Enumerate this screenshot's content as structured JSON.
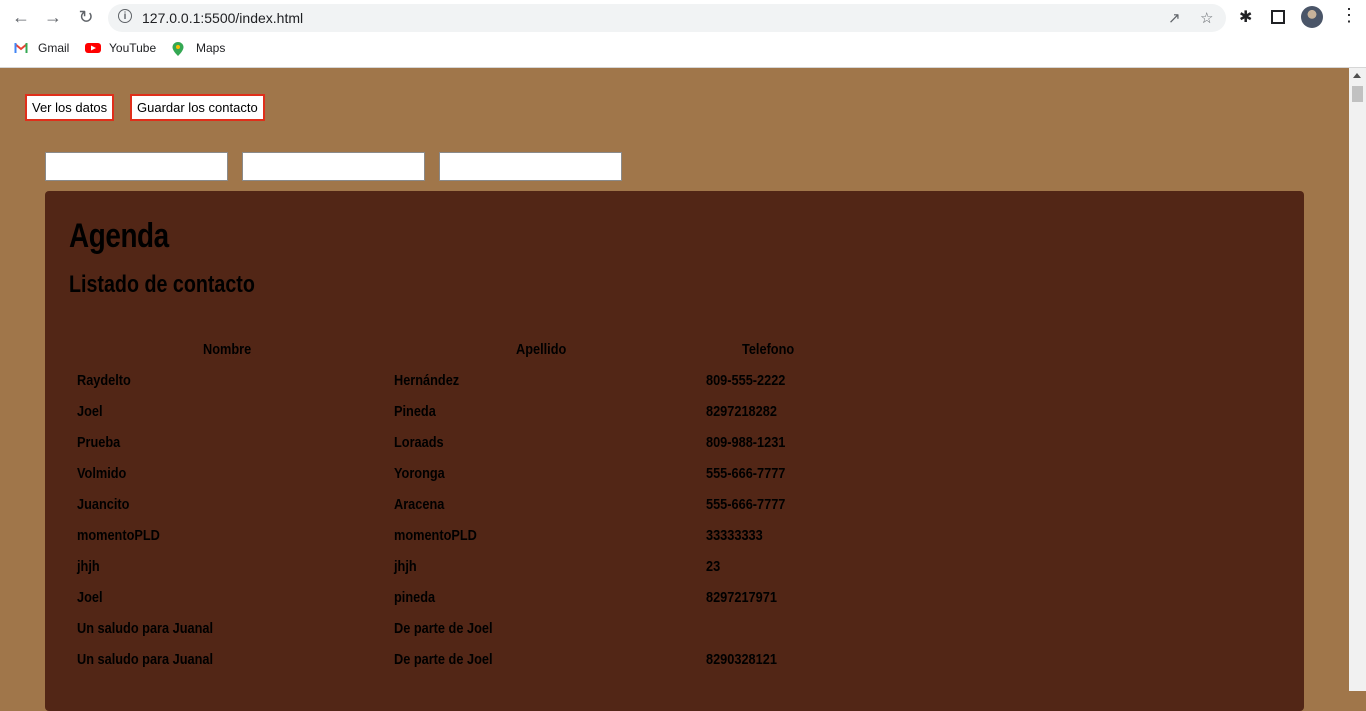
{
  "browser": {
    "url": "127.0.0.1:5500/index.html",
    "bookmarks": [
      {
        "label": "Gmail",
        "icon": "gmail-icon"
      },
      {
        "label": "YouTube",
        "icon": "youtube-icon"
      },
      {
        "label": "Maps",
        "icon": "maps-icon"
      }
    ]
  },
  "toolbar": {
    "view_label": "Ver los datos",
    "save_label": "Guardar los contacto"
  },
  "form": {
    "fields": [
      {
        "value": "",
        "placeholder": ""
      },
      {
        "value": "",
        "placeholder": ""
      },
      {
        "value": "",
        "placeholder": ""
      }
    ]
  },
  "agenda": {
    "title": "Agenda",
    "subtitle": "Listado de contacto",
    "headers": [
      "Nombre",
      "Apellido",
      "Telefono"
    ],
    "rows": [
      {
        "nombre": "Raydelto",
        "apellido": "Hernández",
        "telefono": "809-555-2222"
      },
      {
        "nombre": "Joel",
        "apellido": "Pineda",
        "telefono": "8297218282"
      },
      {
        "nombre": "Prueba",
        "apellido": "Loraads",
        "telefono": "809-988-1231"
      },
      {
        "nombre": "Volmido",
        "apellido": "Yoronga",
        "telefono": "555-666-7777"
      },
      {
        "nombre": "Juancito",
        "apellido": "Aracena",
        "telefono": "555-666-7777"
      },
      {
        "nombre": "momentoPLD",
        "apellido": "momentoPLD",
        "telefono": "33333333"
      },
      {
        "nombre": "jhjh",
        "apellido": "jhjh",
        "telefono": "23"
      },
      {
        "nombre": "Joel",
        "apellido": "pineda",
        "telefono": "8297217971"
      },
      {
        "nombre": "Un saludo para Juanal",
        "apellido": "De parte de Joel",
        "telefono": ""
      },
      {
        "nombre": "Un saludo para Juanal",
        "apellido": "De parte de Joel",
        "telefono": "8290328121"
      }
    ]
  },
  "colors": {
    "page_background": "#a0764a",
    "panel_background": "#522616",
    "button_border": "#e02f1a"
  }
}
